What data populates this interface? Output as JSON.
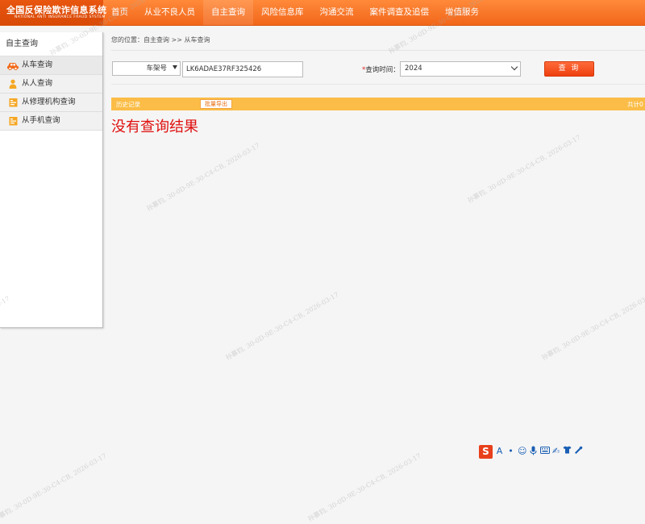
{
  "header": {
    "logo_cn": "全国反保险欺诈信息系统",
    "logo_en": "NATIONAL ANTI INSURANCE FRAUD SYSTEM",
    "nav": [
      "首页",
      "从业不良人员",
      "自主查询",
      "风险信息库",
      "沟通交流",
      "案件调查及追偿",
      "增值服务"
    ],
    "active_index": 2
  },
  "sidebar": {
    "title": "自主查询",
    "items": [
      {
        "label": "从车查询",
        "icon": "car-icon"
      },
      {
        "label": "从人查询",
        "icon": "person-icon"
      },
      {
        "label": "从修理机构查询",
        "icon": "repair-shop-icon"
      },
      {
        "label": "从手机查询",
        "icon": "phone-icon"
      }
    ]
  },
  "breadcrumb": "您的位置：自主查询 >> 从车查询",
  "form": {
    "type_select": "车架号",
    "vin_value": "LK6ADAE37RF325426",
    "time_label": "查询时间：",
    "year_value": "2024",
    "search_label": "查 询"
  },
  "history": {
    "label": "历史记录",
    "export_label": "批量导出",
    "total_label": "共计0"
  },
  "no_result": "没有查询结果",
  "watermark_text": "孙慕钧, 30-0D-9E-30-C4-CB, 2026-03-17",
  "colors": {
    "nav_bg": "#f2661a",
    "history_bar": "#fbbd47",
    "button": "#ee3f0f",
    "no_result": "#e01010"
  }
}
